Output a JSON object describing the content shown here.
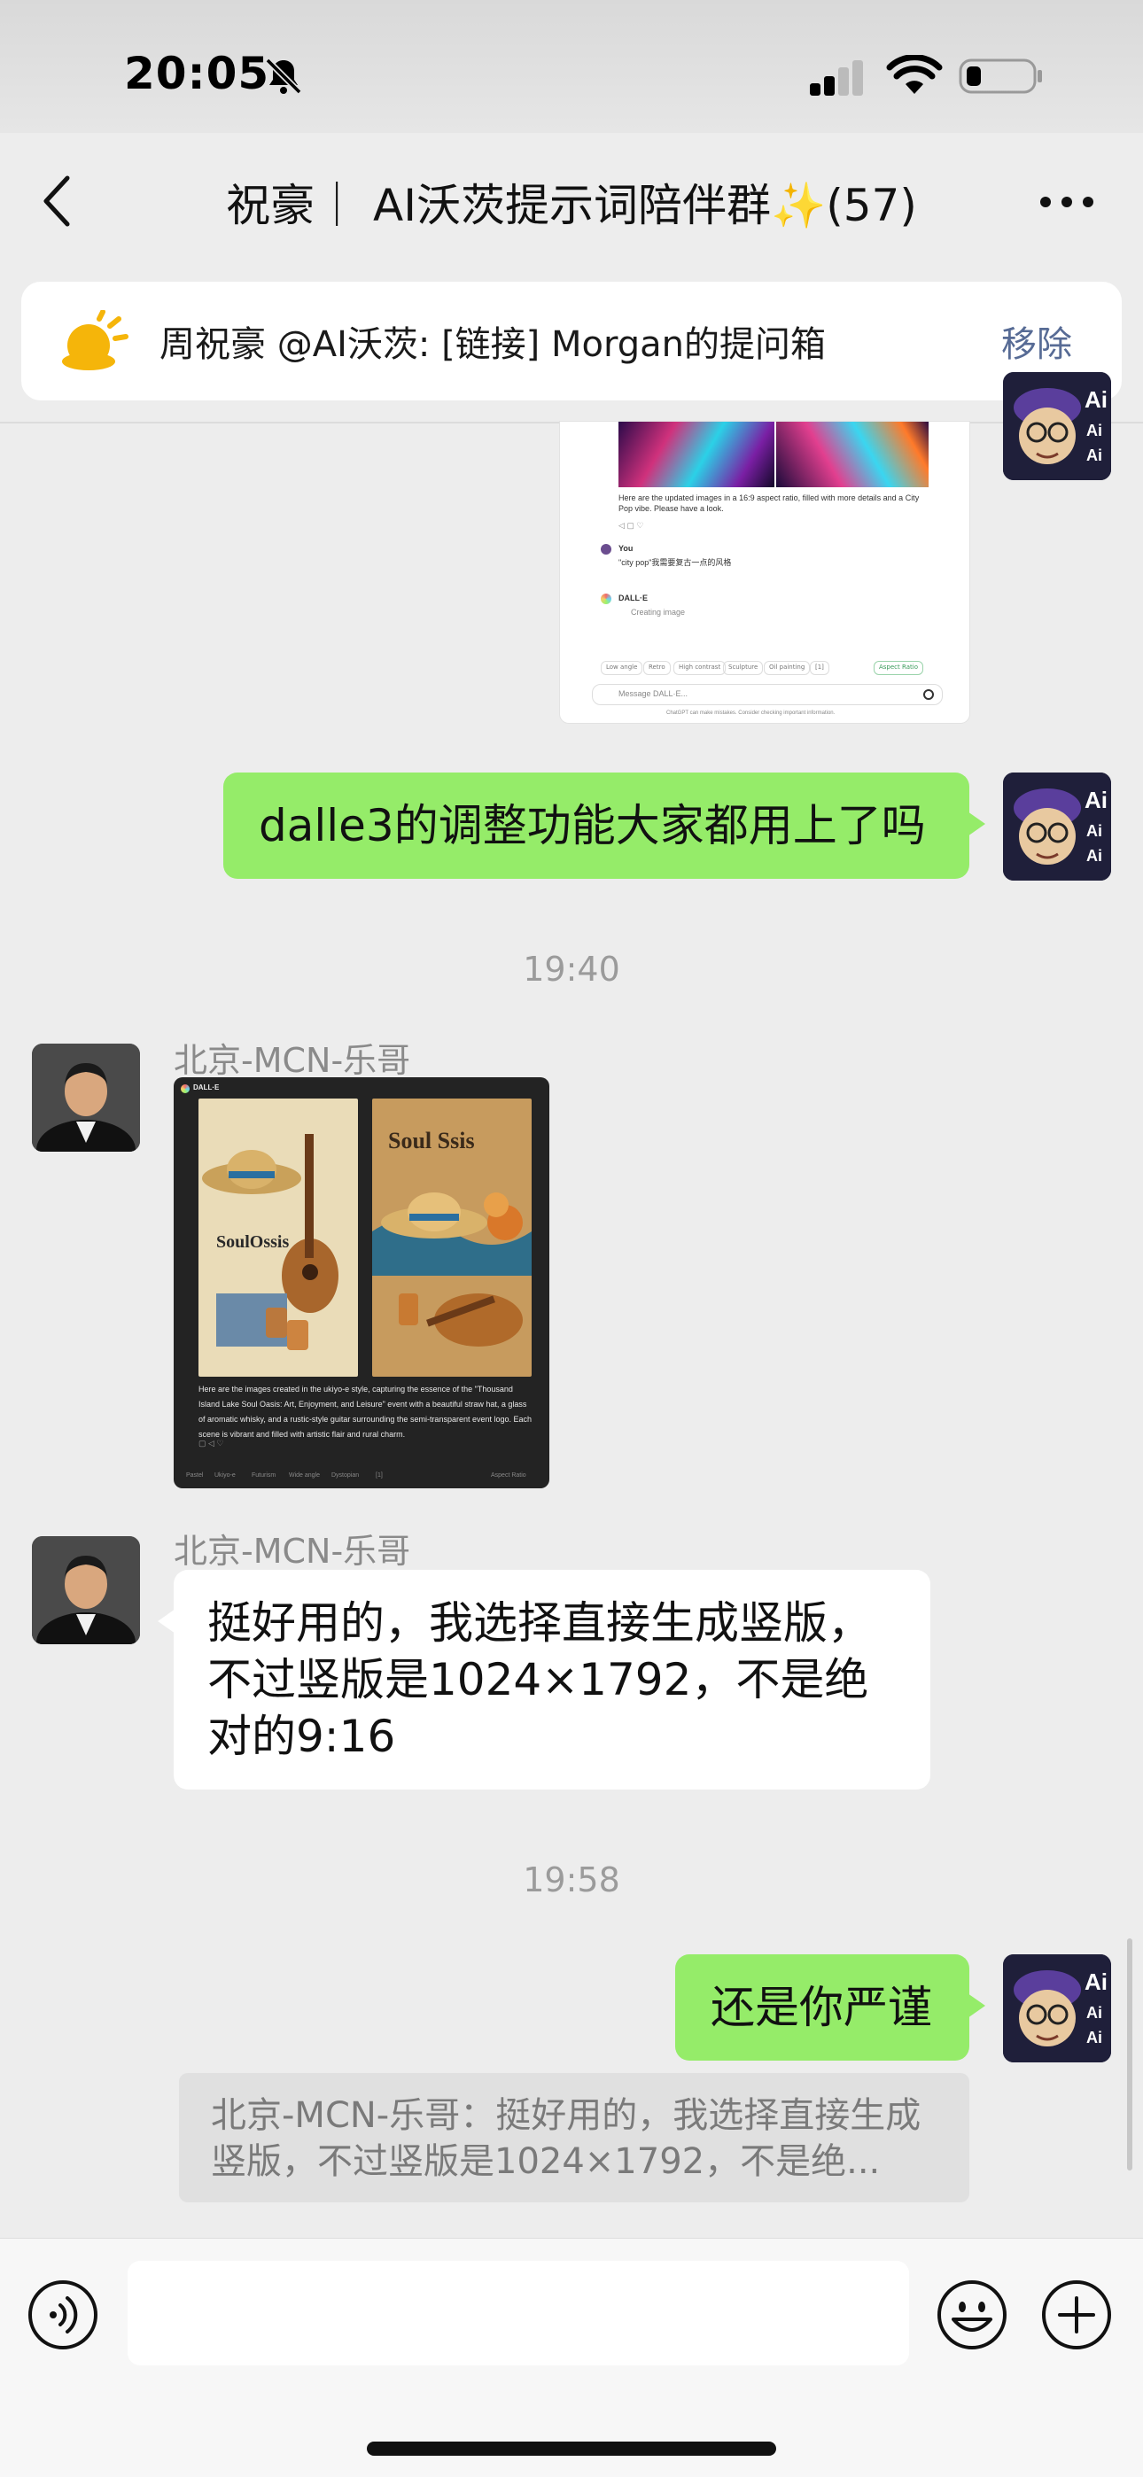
{
  "status_bar": {
    "time": "20:05"
  },
  "header": {
    "title": "祝豪｜ AI沃茨提示词陪伴群✨(57)"
  },
  "pinned": {
    "text": "周祝豪 @AI沃茨: [链接] Morgan的提问箱",
    "remove_label": "移除"
  },
  "shot1": {
    "caption": "Here are the updated images in a 16:9 aspect ratio, filled with more details and a City Pop vibe. Please have a look.",
    "you_label": "You",
    "you_text": "\"city pop\"我需要复古一点的风格",
    "dalle_label": "DALL·E",
    "creating": "Creating image",
    "chips": [
      "Low angle",
      "Retro",
      "High contrast",
      "Sculpture",
      "Oil painting",
      "[1]"
    ],
    "aspect_chip": "Aspect Ratio",
    "placeholder": "Message DALL·E...",
    "disclaimer": "ChatGPT can make mistakes. Consider checking important information."
  },
  "messages": {
    "m1": "dalle3的调整功能大家都用上了吗",
    "t1": "19:40",
    "sender1": "北京-MCN-乐哥",
    "sender2": "北京-MCN-乐哥",
    "m2": "挺好用的，我选择直接生成竖版，不过竖版是1024×1792，不是绝对的9:16",
    "t2": "19:58",
    "m3": "还是你严谨"
  },
  "shot2": {
    "header": "DALL·E",
    "caption": "Here are the images created in the ukiyo-e style, capturing the essence of the \"Thousand Island Lake Soul Oasis: Art, Enjoyment, and Leisure\" event with a beautiful straw hat, a glass of aromatic whisky, and a rustic-style guitar surrounding the semi-transparent event logo. Each scene is vibrant and filled with artistic flair and rural charm.",
    "chips": [
      "Pastel",
      "Ukiyo-e",
      "Futurism",
      "Wide angle",
      "Dystopian",
      "[1]"
    ],
    "aspect_chip": "Aspect Ratio",
    "poster1_title": "SoulOssis",
    "poster2_title": "Soul Ssis"
  },
  "quote": {
    "text": "北京-MCN-乐哥：挺好用的，我选择直接生成竖版，不过竖版是1024×1792，不是绝..."
  },
  "icons": [
    "bell-slash-icon",
    "signal-icon",
    "wifi-icon",
    "battery-icon",
    "back-icon",
    "more-icon",
    "sun-icon",
    "voice-icon",
    "emoji-icon",
    "plus-icon"
  ]
}
